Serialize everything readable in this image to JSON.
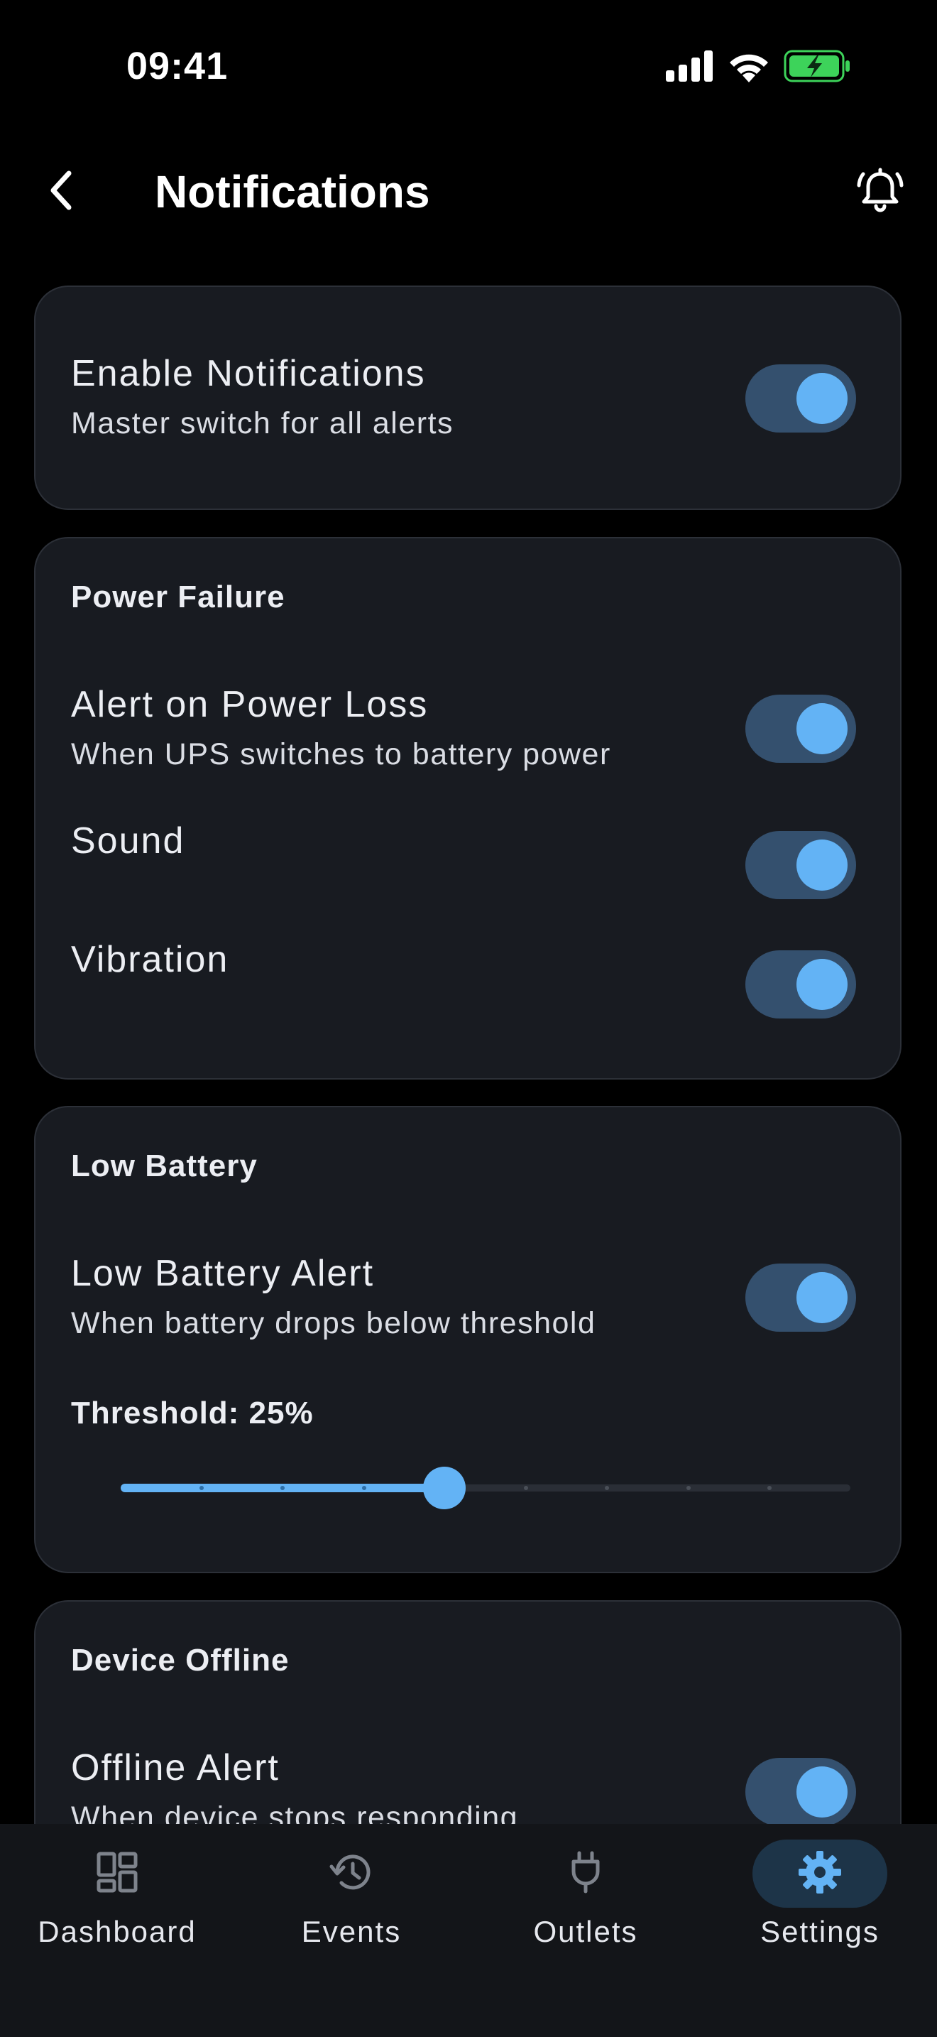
{
  "status_bar": {
    "time": "09:41",
    "icons": [
      "signal-icon",
      "wifi-icon",
      "battery-charging-icon"
    ]
  },
  "header": {
    "title": "Notifications",
    "back_icon": "chevron-left-icon",
    "action_icon": "bell-ring-icon"
  },
  "master": {
    "title": "Enable Notifications",
    "subtitle": "Master switch for all alerts",
    "enabled": true
  },
  "power_failure": {
    "section_title": "Power Failure",
    "alert_title": "Alert on Power Loss",
    "alert_subtitle": "When UPS switches to battery power",
    "alert_enabled": true,
    "sound_label": "Sound",
    "sound_enabled": true,
    "vibration_label": "Vibration",
    "vibration_enabled": true
  },
  "low_battery": {
    "section_title": "Low Battery",
    "alert_title": "Low Battery Alert",
    "alert_subtitle": "When battery drops below threshold",
    "alert_enabled": true,
    "threshold_label": "Threshold: 25%",
    "threshold_fraction": 0.444,
    "slider_steps": 9
  },
  "device_offline": {
    "section_title": "Device Offline",
    "alert_title": "Offline Alert",
    "alert_subtitle": "When device stops responding",
    "alert_enabled": true
  },
  "nav": {
    "items": [
      {
        "label": "Dashboard",
        "icon": "dashboard-icon",
        "active": false
      },
      {
        "label": "Events",
        "icon": "history-icon",
        "active": false
      },
      {
        "label": "Outlets",
        "icon": "plug-icon",
        "active": false
      },
      {
        "label": "Settings",
        "icon": "gear-icon",
        "active": true
      }
    ]
  },
  "colors": {
    "background": "#000000",
    "card": "#181B21",
    "accent": "#63B3F5",
    "toggle_track": "#34506E",
    "battery_green": "#3DD35A"
  }
}
